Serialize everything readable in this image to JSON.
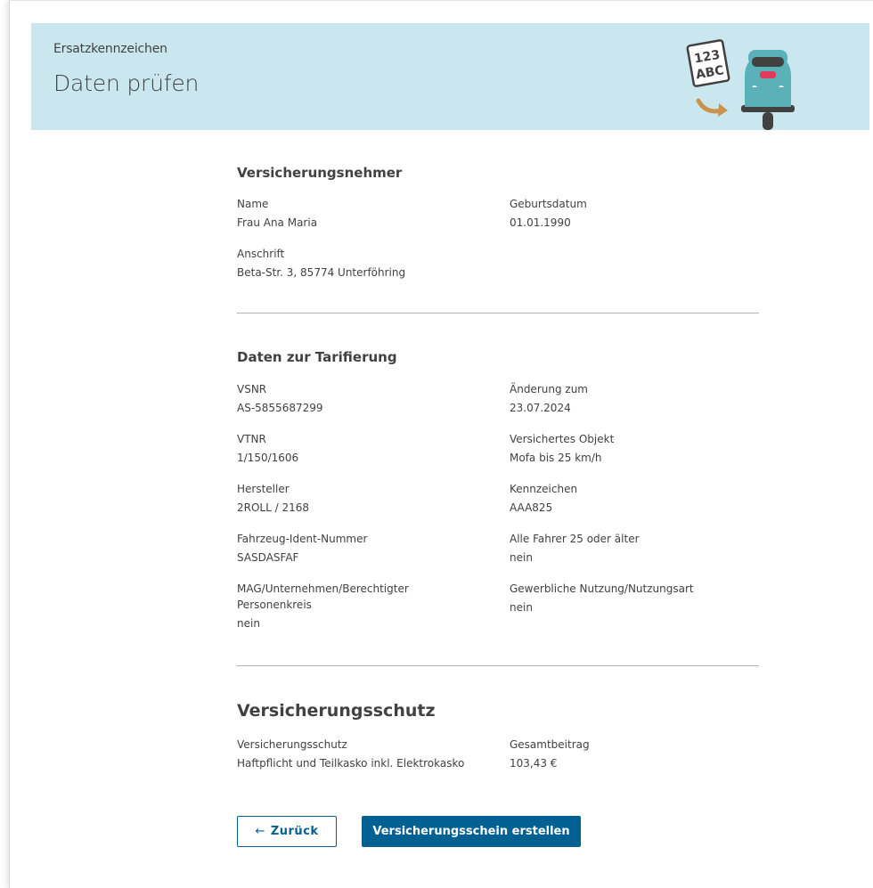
{
  "header": {
    "subtitle": "Ersatzkennzeichen",
    "title": "Daten prüfen",
    "plate_line1": "123",
    "plate_line2": "ABC"
  },
  "sections": {
    "policyholder": {
      "title": "Versicherungsnehmer",
      "name": {
        "label": "Name",
        "value": "Frau Ana Maria"
      },
      "birthdate": {
        "label": "Geburtsdatum",
        "value": "01.01.1990"
      },
      "address": {
        "label": "Anschrift",
        "value": "Beta-Str. 3, 85774 Unterföhring"
      }
    },
    "tariff": {
      "title": "Daten zur Tarifierung",
      "vsnr": {
        "label": "VSNR",
        "value": "AS-5855687299"
      },
      "change_date": {
        "label": "Änderung zum",
        "value": "23.07.2024"
      },
      "vtnr": {
        "label": "VTNR",
        "value": "1/150/1606"
      },
      "insured_object": {
        "label": "Versichertes Objekt",
        "value": "Mofa bis 25 km/h"
      },
      "manufacturer": {
        "label": "Hersteller",
        "value": "2ROLL / 2168"
      },
      "plate": {
        "label": "Kennzeichen",
        "value": "AAA825"
      },
      "vin": {
        "label": "Fahrzeug-Ident-Nummer",
        "value": "SASDASFAF"
      },
      "drivers_25": {
        "label": "Alle Fahrer 25 oder älter",
        "value": "nein"
      },
      "mag_line1": "MAG/Unternehmen/Berechtigter",
      "mag_line2": "Personenkreis",
      "mag_value": "nein",
      "commercial": {
        "label": "Gewerbliche Nutzung/Nutzungsart",
        "value": "nein"
      }
    },
    "coverage": {
      "title": "Versicherungsschutz",
      "coverage": {
        "label": "Versicherungsschutz",
        "value": "Haftpflicht und Teilkasko inkl. Elektrokasko"
      },
      "total": {
        "label": "Gesamtbeitrag",
        "value": "103,43 €"
      }
    }
  },
  "buttons": {
    "back_arrow": "←",
    "back": "Zurück",
    "submit": "Versicherungsschein erstellen"
  },
  "colors": {
    "header_bg": "#cae7ef",
    "primary": "#006192",
    "scooter": "#5ab1b7"
  }
}
